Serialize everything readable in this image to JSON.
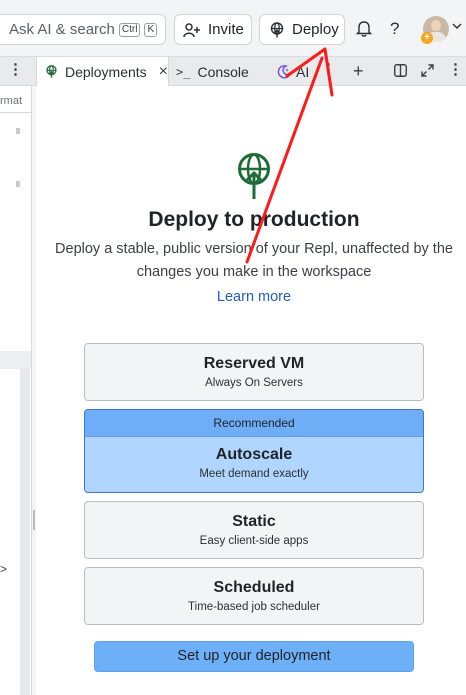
{
  "topbar": {
    "search_placeholder": "Ask AI & search",
    "shortcut_keys": [
      "Ctrl",
      "K"
    ],
    "invite_label": "Invite",
    "deploy_label": "Deploy",
    "help_label": "?"
  },
  "tabs": {
    "items": [
      {
        "label": "Deployments",
        "active": true
      },
      {
        "label": "Console",
        "active": false
      },
      {
        "label": "AI",
        "active": false
      }
    ],
    "close_glyph": "×",
    "menu_glyph": "⋮"
  },
  "left_pane": {
    "fragment_text": "rmat",
    "expand_glyph": ">"
  },
  "deployments": {
    "title": "Deploy to production",
    "subtitle": "Deploy a stable, public version of your Repl, unaffected by the changes you make in the workspace",
    "learn_more": "Learn more",
    "options": [
      {
        "name": "Reserved VM",
        "description": "Always On Servers",
        "selected": false
      },
      {
        "name": "Autoscale",
        "description": "Meet demand exactly",
        "selected": true,
        "badge": "Recommended"
      },
      {
        "name": "Static",
        "description": "Easy client-side apps",
        "selected": false
      },
      {
        "name": "Scheduled",
        "description": "Time-based job scheduler",
        "selected": false
      }
    ],
    "setup_button": "Set up your deployment"
  },
  "colors": {
    "brand_green": "#1e6b35",
    "selected_card": "#b0d6ff",
    "recommended_banner": "#6faef7",
    "primary_button": "#6eb0f8",
    "annotation_arrow": "#ff1a1a",
    "link": "#1f5fbf"
  },
  "icons": [
    "deploy-globe-icon",
    "add-user-icon",
    "bell-icon",
    "console-icon",
    "ai-sparkle-icon",
    "plus-icon",
    "split-pane-icon",
    "expand-icon"
  ]
}
